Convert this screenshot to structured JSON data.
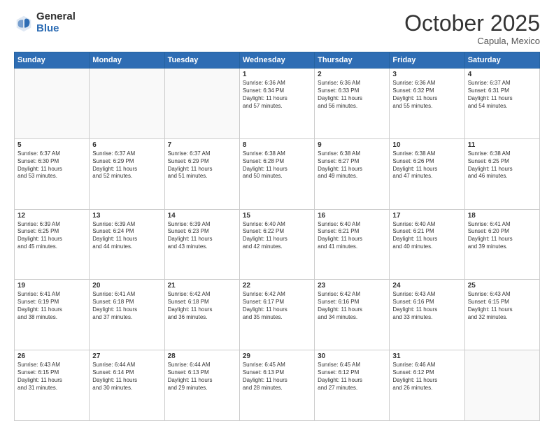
{
  "header": {
    "logo_general": "General",
    "logo_blue": "Blue",
    "month": "October 2025",
    "location": "Capula, Mexico"
  },
  "days_of_week": [
    "Sunday",
    "Monday",
    "Tuesday",
    "Wednesday",
    "Thursday",
    "Friday",
    "Saturday"
  ],
  "weeks": [
    [
      {
        "num": "",
        "info": ""
      },
      {
        "num": "",
        "info": ""
      },
      {
        "num": "",
        "info": ""
      },
      {
        "num": "1",
        "info": "Sunrise: 6:36 AM\nSunset: 6:34 PM\nDaylight: 11 hours\nand 57 minutes."
      },
      {
        "num": "2",
        "info": "Sunrise: 6:36 AM\nSunset: 6:33 PM\nDaylight: 11 hours\nand 56 minutes."
      },
      {
        "num": "3",
        "info": "Sunrise: 6:36 AM\nSunset: 6:32 PM\nDaylight: 11 hours\nand 55 minutes."
      },
      {
        "num": "4",
        "info": "Sunrise: 6:37 AM\nSunset: 6:31 PM\nDaylight: 11 hours\nand 54 minutes."
      }
    ],
    [
      {
        "num": "5",
        "info": "Sunrise: 6:37 AM\nSunset: 6:30 PM\nDaylight: 11 hours\nand 53 minutes."
      },
      {
        "num": "6",
        "info": "Sunrise: 6:37 AM\nSunset: 6:29 PM\nDaylight: 11 hours\nand 52 minutes."
      },
      {
        "num": "7",
        "info": "Sunrise: 6:37 AM\nSunset: 6:29 PM\nDaylight: 11 hours\nand 51 minutes."
      },
      {
        "num": "8",
        "info": "Sunrise: 6:38 AM\nSunset: 6:28 PM\nDaylight: 11 hours\nand 50 minutes."
      },
      {
        "num": "9",
        "info": "Sunrise: 6:38 AM\nSunset: 6:27 PM\nDaylight: 11 hours\nand 49 minutes."
      },
      {
        "num": "10",
        "info": "Sunrise: 6:38 AM\nSunset: 6:26 PM\nDaylight: 11 hours\nand 47 minutes."
      },
      {
        "num": "11",
        "info": "Sunrise: 6:38 AM\nSunset: 6:25 PM\nDaylight: 11 hours\nand 46 minutes."
      }
    ],
    [
      {
        "num": "12",
        "info": "Sunrise: 6:39 AM\nSunset: 6:25 PM\nDaylight: 11 hours\nand 45 minutes."
      },
      {
        "num": "13",
        "info": "Sunrise: 6:39 AM\nSunset: 6:24 PM\nDaylight: 11 hours\nand 44 minutes."
      },
      {
        "num": "14",
        "info": "Sunrise: 6:39 AM\nSunset: 6:23 PM\nDaylight: 11 hours\nand 43 minutes."
      },
      {
        "num": "15",
        "info": "Sunrise: 6:40 AM\nSunset: 6:22 PM\nDaylight: 11 hours\nand 42 minutes."
      },
      {
        "num": "16",
        "info": "Sunrise: 6:40 AM\nSunset: 6:21 PM\nDaylight: 11 hours\nand 41 minutes."
      },
      {
        "num": "17",
        "info": "Sunrise: 6:40 AM\nSunset: 6:21 PM\nDaylight: 11 hours\nand 40 minutes."
      },
      {
        "num": "18",
        "info": "Sunrise: 6:41 AM\nSunset: 6:20 PM\nDaylight: 11 hours\nand 39 minutes."
      }
    ],
    [
      {
        "num": "19",
        "info": "Sunrise: 6:41 AM\nSunset: 6:19 PM\nDaylight: 11 hours\nand 38 minutes."
      },
      {
        "num": "20",
        "info": "Sunrise: 6:41 AM\nSunset: 6:18 PM\nDaylight: 11 hours\nand 37 minutes."
      },
      {
        "num": "21",
        "info": "Sunrise: 6:42 AM\nSunset: 6:18 PM\nDaylight: 11 hours\nand 36 minutes."
      },
      {
        "num": "22",
        "info": "Sunrise: 6:42 AM\nSunset: 6:17 PM\nDaylight: 11 hours\nand 35 minutes."
      },
      {
        "num": "23",
        "info": "Sunrise: 6:42 AM\nSunset: 6:16 PM\nDaylight: 11 hours\nand 34 minutes."
      },
      {
        "num": "24",
        "info": "Sunrise: 6:43 AM\nSunset: 6:16 PM\nDaylight: 11 hours\nand 33 minutes."
      },
      {
        "num": "25",
        "info": "Sunrise: 6:43 AM\nSunset: 6:15 PM\nDaylight: 11 hours\nand 32 minutes."
      }
    ],
    [
      {
        "num": "26",
        "info": "Sunrise: 6:43 AM\nSunset: 6:15 PM\nDaylight: 11 hours\nand 31 minutes."
      },
      {
        "num": "27",
        "info": "Sunrise: 6:44 AM\nSunset: 6:14 PM\nDaylight: 11 hours\nand 30 minutes."
      },
      {
        "num": "28",
        "info": "Sunrise: 6:44 AM\nSunset: 6:13 PM\nDaylight: 11 hours\nand 29 minutes."
      },
      {
        "num": "29",
        "info": "Sunrise: 6:45 AM\nSunset: 6:13 PM\nDaylight: 11 hours\nand 28 minutes."
      },
      {
        "num": "30",
        "info": "Sunrise: 6:45 AM\nSunset: 6:12 PM\nDaylight: 11 hours\nand 27 minutes."
      },
      {
        "num": "31",
        "info": "Sunrise: 6:46 AM\nSunset: 6:12 PM\nDaylight: 11 hours\nand 26 minutes."
      },
      {
        "num": "",
        "info": ""
      }
    ]
  ]
}
